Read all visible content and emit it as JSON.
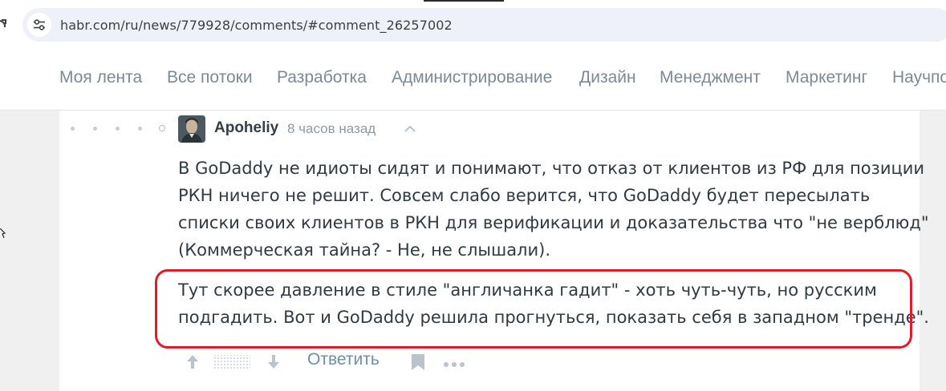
{
  "browser": {
    "url": "habr.com/ru/news/779928/comments/#comment_26257002"
  },
  "nav": {
    "items": [
      "Моя лента",
      "Все потоки",
      "Разработка",
      "Администрирование",
      "Дизайн",
      "Менеджмент",
      "Маркетинг",
      "Научпоп"
    ]
  },
  "comment": {
    "author": "Apoheliy",
    "time": "8 часов назад",
    "paragraphs": [
      [
        "В GoDaddy не идиоты сидят и понимают, что отказ от клиентов из РФ для позиции",
        "РКН ничего не решит. Совсем слабо верится, что GoDaddy будет пересылать",
        "списки своих клиентов в РКН для верификации и доказательства что \"не верблюд\"",
        "(Коммерческая тайна? - Не, не слышали)."
      ],
      [
        "Тут скорее давление в стиле \"англичанка гадит\" - хоть чуть-чуть, но русским",
        "подгадить. Вот и GoDaddy решила прогнуться, показать себя в западном \"тренде\"."
      ]
    ],
    "reply_label": "Ответить"
  },
  "colors": {
    "highlight": "#e21b2a",
    "nav_text": "#7b8a95",
    "reply_link": "#6d8ea7"
  },
  "icons": {
    "site_info": "tune-icon",
    "vote_up": "arrow-up-icon",
    "vote_down": "arrow-down-icon",
    "bookmark": "bookmark-icon",
    "more": "more-icon",
    "parent": "chevron-up-icon"
  }
}
